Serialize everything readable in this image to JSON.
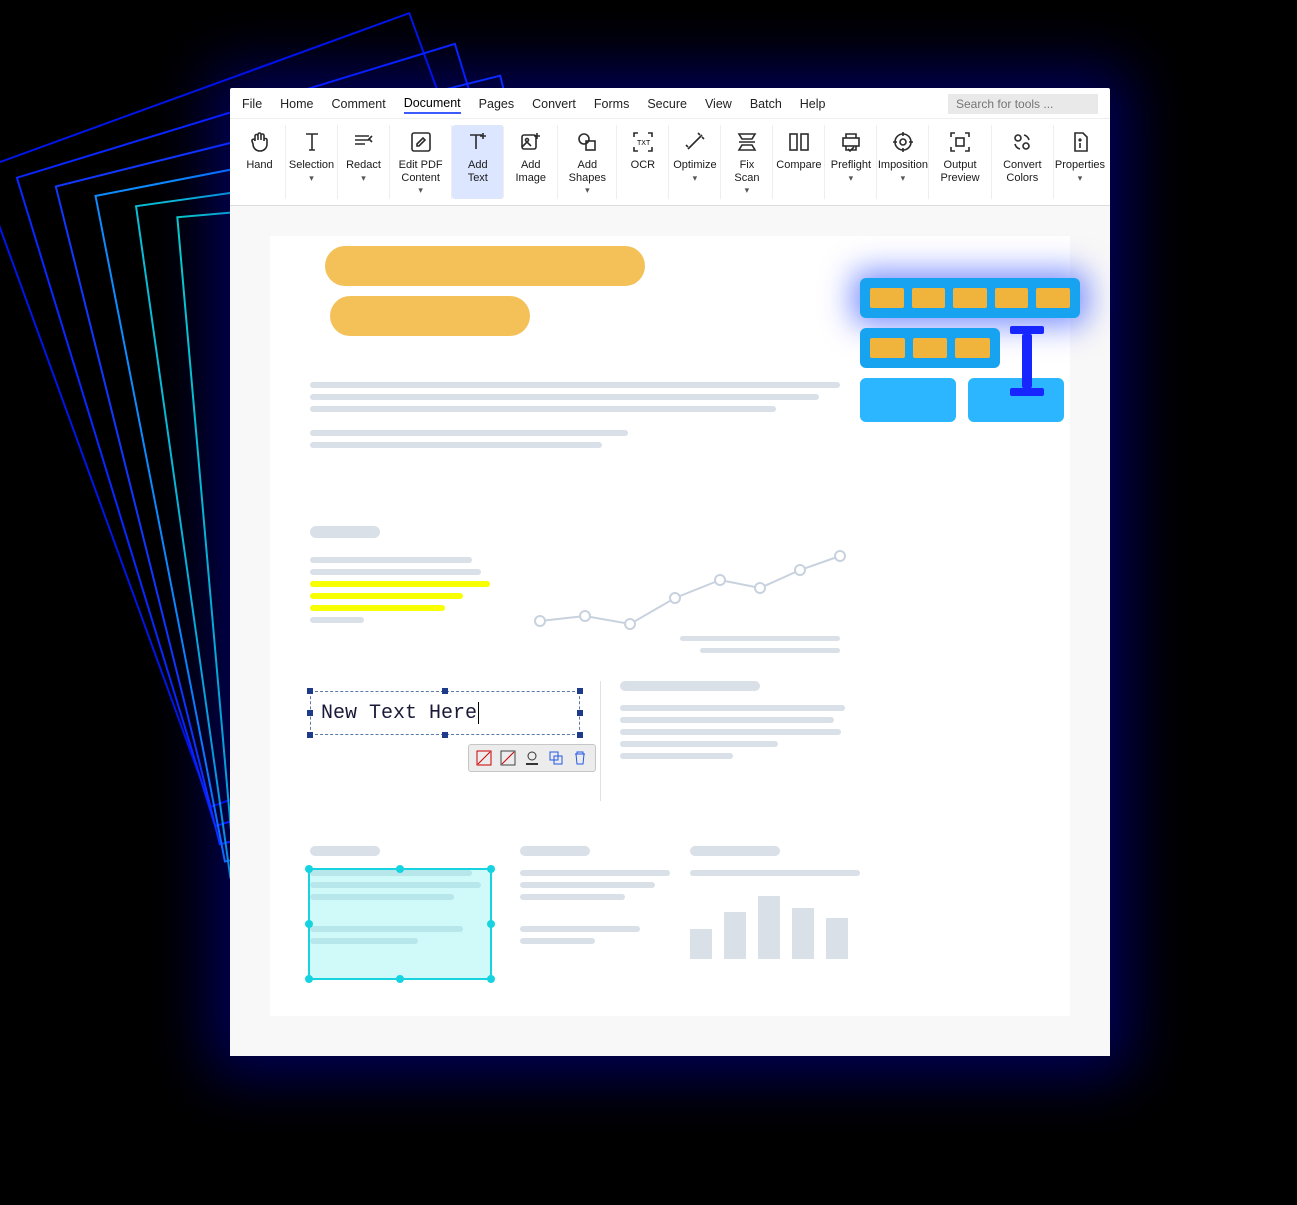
{
  "menubar": {
    "items": [
      "File",
      "Home",
      "Comment",
      "Document",
      "Pages",
      "Convert",
      "Forms",
      "Secure",
      "View",
      "Batch",
      "Help"
    ],
    "active_index": 3,
    "search_placeholder": "Search for tools ..."
  },
  "ribbon": {
    "buttons": [
      {
        "id": "hand",
        "label": "Hand",
        "icon": "hand",
        "dropdown": false
      },
      {
        "id": "selection",
        "label": "Selection",
        "icon": "text-cursor",
        "dropdown": true
      },
      {
        "id": "redact",
        "label": "Redact",
        "icon": "redact",
        "dropdown": true
      },
      {
        "id": "edit-pdf-content",
        "label": "Edit PDF Content",
        "icon": "pencil-box",
        "dropdown": true
      },
      {
        "id": "add-text",
        "label": "Add Text",
        "icon": "add-text",
        "dropdown": false,
        "active": true
      },
      {
        "id": "add-image",
        "label": "Add Image",
        "icon": "add-image",
        "dropdown": false
      },
      {
        "id": "add-shapes",
        "label": "Add Shapes",
        "icon": "add-shape",
        "dropdown": true
      },
      {
        "id": "ocr",
        "label": "OCR",
        "icon": "ocr",
        "dropdown": false
      },
      {
        "id": "optimize",
        "label": "Optimize",
        "icon": "wand",
        "dropdown": true
      },
      {
        "id": "fix-scan",
        "label": "Fix Scan",
        "icon": "scan",
        "dropdown": true
      },
      {
        "id": "compare",
        "label": "Compare",
        "icon": "compare",
        "dropdown": false
      },
      {
        "id": "preflight",
        "label": "Preflight",
        "icon": "printer-check",
        "dropdown": true
      },
      {
        "id": "imposition",
        "label": "Imposition",
        "icon": "target",
        "dropdown": true
      },
      {
        "id": "output-preview",
        "label": "Output Preview",
        "icon": "crop",
        "dropdown": false
      },
      {
        "id": "convert-colors",
        "label": "Convert Colors",
        "icon": "colors",
        "dropdown": false
      },
      {
        "id": "properties",
        "label": "Properties",
        "icon": "info",
        "dropdown": true
      }
    ]
  },
  "document": {
    "new_text_value": "New Text Here",
    "edit_toolbar_icons": [
      "no-fill",
      "no-border",
      "underline-color",
      "copy-format",
      "delete"
    ],
    "highlight_color": "#f8ff00",
    "title_bar_color": "#f3c158",
    "selection_color": "#17d3e0"
  },
  "chart_data": {
    "type": "line",
    "x": [
      0,
      1,
      2,
      3,
      4,
      5,
      6,
      7
    ],
    "values": [
      20,
      24,
      18,
      34,
      46,
      40,
      52,
      60
    ],
    "ylim": [
      0,
      70
    ],
    "title": "",
    "xlabel": "",
    "ylabel": ""
  },
  "bar_chart": {
    "type": "bar",
    "values": [
      36,
      56,
      74,
      60,
      48
    ]
  }
}
